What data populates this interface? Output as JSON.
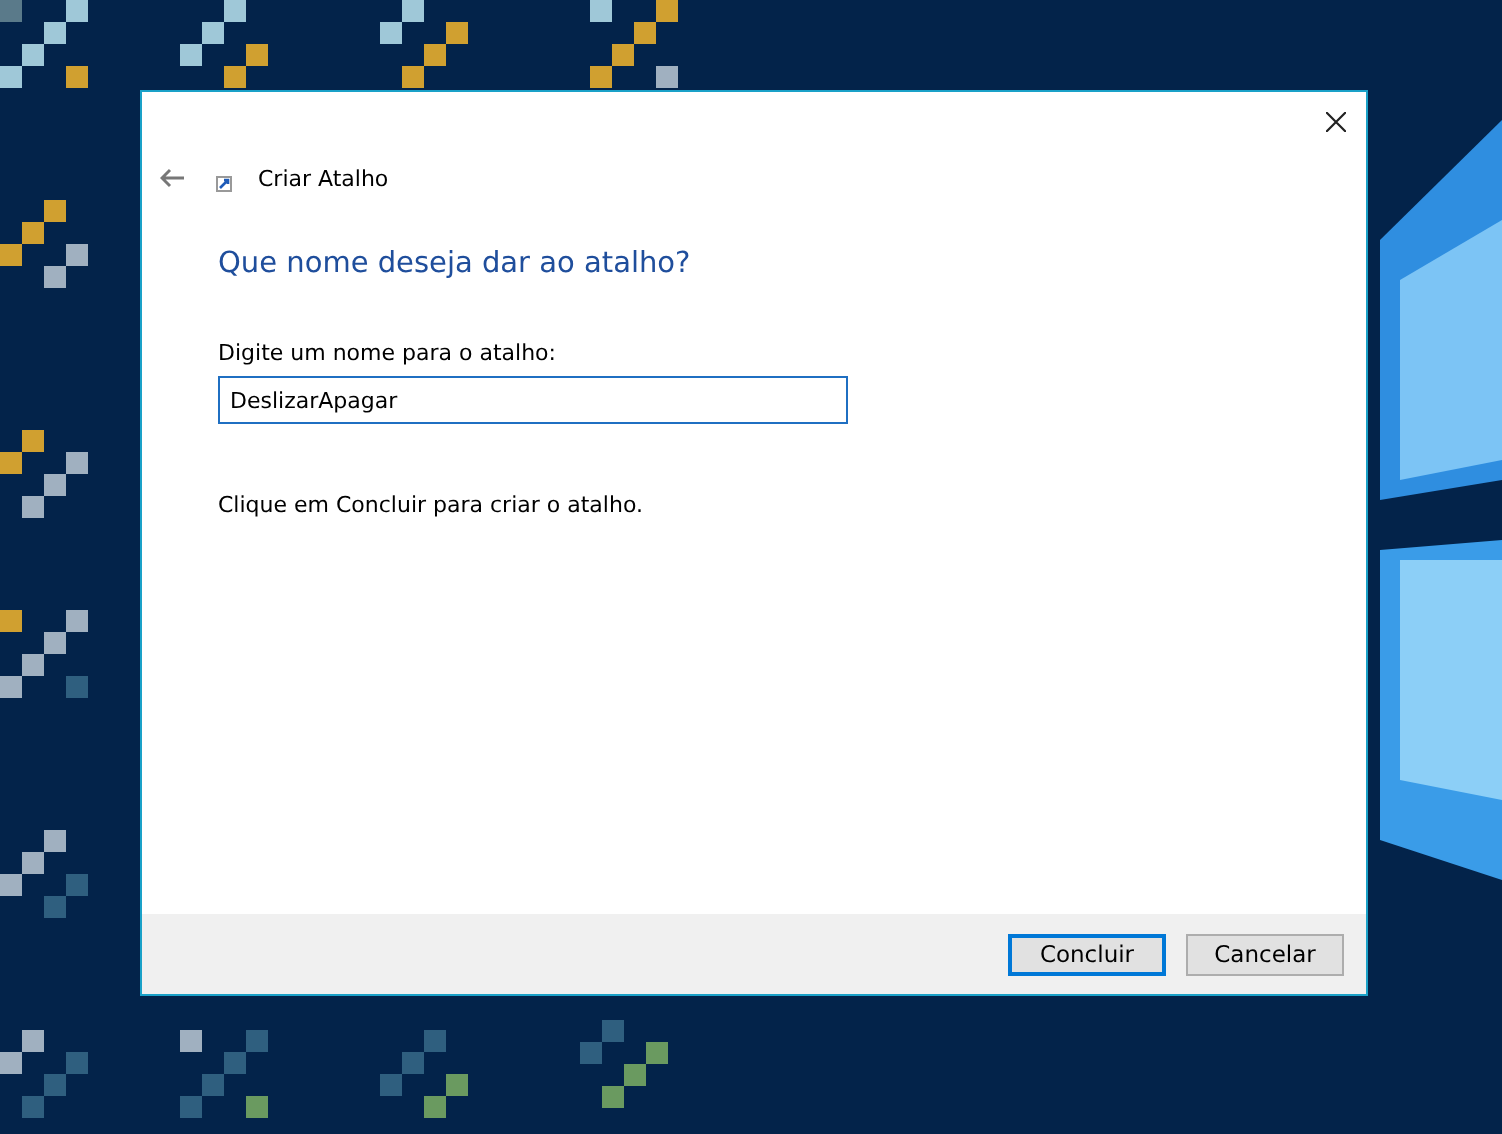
{
  "dialog": {
    "title": "Criar Atalho",
    "heading": "Que nome deseja dar ao atalho?",
    "field_label": "Digite um nome para o atalho:",
    "field_value": "DeslizarApagar",
    "instruction": "Clique em Concluir para criar o atalho.",
    "buttons": [
      {
        "label": "Concluir",
        "default": true
      },
      {
        "label": "Cancelar",
        "default": false
      }
    ]
  }
}
